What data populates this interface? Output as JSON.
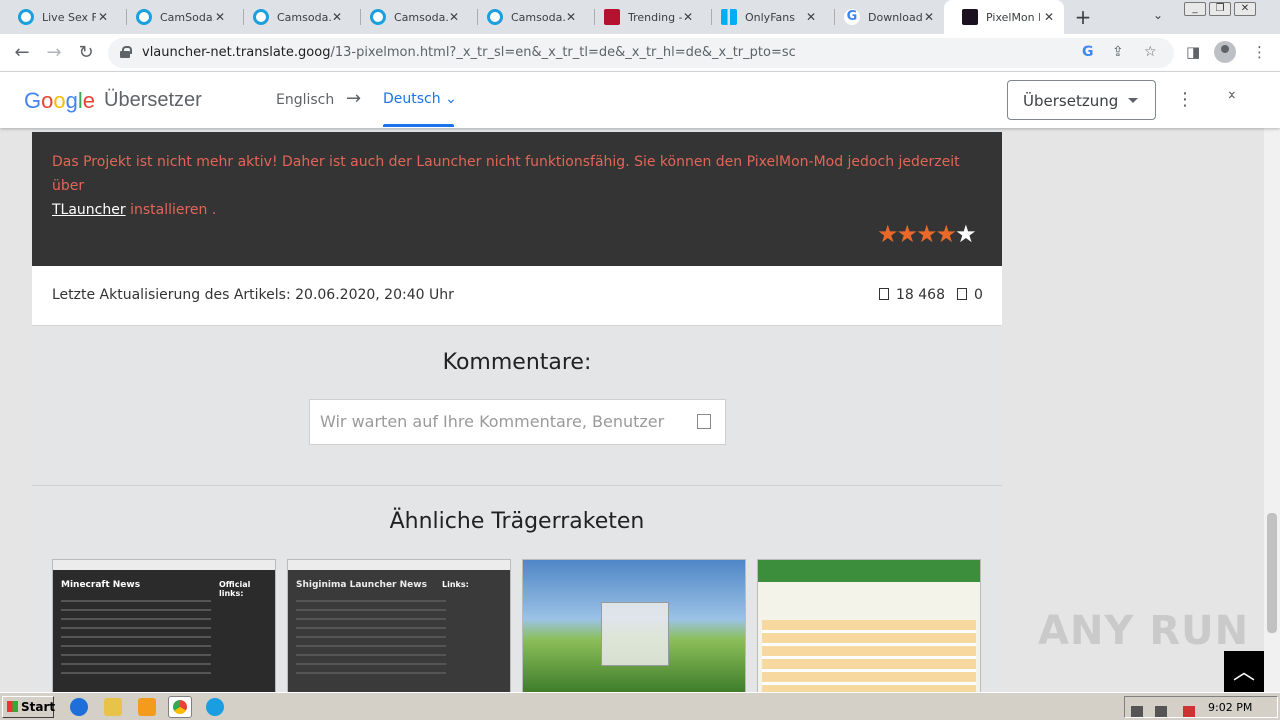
{
  "browser": {
    "tabs": [
      {
        "title": "Live Sex Fr",
        "icon": "camsoda-icon",
        "active": false
      },
      {
        "title": "CamSoda.c",
        "icon": "camsoda-icon",
        "active": false
      },
      {
        "title": "Camsoda.c",
        "icon": "camsoda-icon",
        "active": false
      },
      {
        "title": "Camsoda.c",
        "icon": "camsoda-icon",
        "active": false
      },
      {
        "title": "Camsoda.c",
        "icon": "camsoda-icon",
        "active": false
      },
      {
        "title": "Trending - I",
        "icon": "trending-icon",
        "active": false
      },
      {
        "title": "OnlyFans L",
        "icon": "onlyfans-icon",
        "active": false
      },
      {
        "title": "Download",
        "icon": "google-icon",
        "active": false
      },
      {
        "title": "PixelMon L",
        "icon": "pixelmon-icon",
        "active": true
      }
    ],
    "close_glyph": "✕",
    "new_tab_glyph": "+",
    "url_host": "vlauncher-net.translate.goog",
    "url_rest": "/13-pixelmon.html?_x_tr_sl=en&_x_tr_tl=de&_x_tr_hl=de&_x_tr_pto=sc"
  },
  "translate_bar": {
    "google": "Google",
    "product": "Übersetzer",
    "source_lang": "Englisch",
    "arrow": "→",
    "target_lang": "Deutsch",
    "mode": "Übersetzung"
  },
  "article": {
    "notice_text": "Das Projekt ist nicht mehr aktiv! Daher ist auch der Launcher nicht funktionsfähig. Sie können den PixelMon-Mod jedoch jederzeit über",
    "notice_link": "TLauncher",
    "notice_end": " installieren .",
    "rating": 4,
    "rating_max": 5,
    "updated": "Letzte Aktualisierung des Artikels: 20.06.2020, 20:40 Uhr",
    "views": "18 468",
    "comments": "0"
  },
  "comments": {
    "title": "Kommentare:",
    "placeholder": "Wir warten auf Ihre Kommentare, Benutzer"
  },
  "similar": {
    "title": "Ähnliche Trägerraketen",
    "thumbs": [
      {
        "caption": "Minecraft News",
        "side": "Official links:"
      },
      {
        "caption": "Shiginima Launcher News",
        "side": "Links:"
      },
      {
        "caption": "",
        "side": ""
      },
      {
        "caption": "",
        "side": ""
      }
    ]
  },
  "watermark": "ANY RUN",
  "taskbar": {
    "start": "Start",
    "clock": "9:02 PM"
  },
  "colors": {
    "accent_blue": "#1a73e8",
    "notice_red": "#e16658",
    "star_orange": "#e8692a",
    "dark_box": "#343434"
  }
}
